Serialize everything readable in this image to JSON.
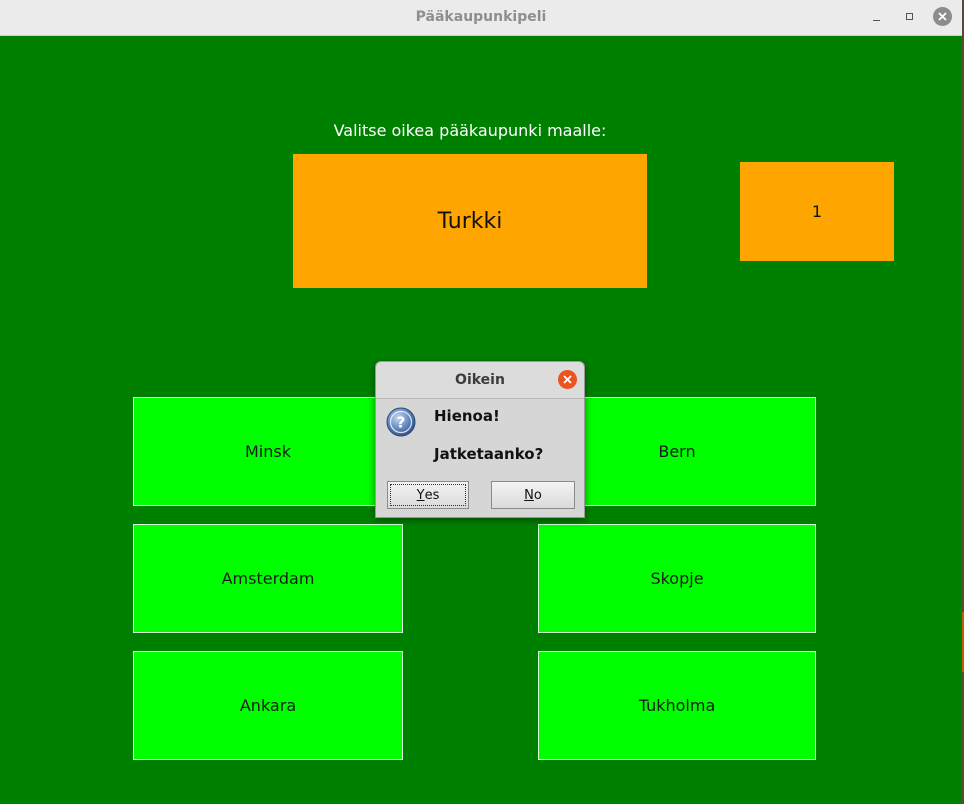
{
  "window": {
    "title": "Pääkaupunkipeli"
  },
  "game": {
    "prompt": "Valitse oikea pääkaupunki maalle:",
    "country": "Turkki",
    "score": "1",
    "answers": [
      "Minsk",
      "Bern",
      "Amsterdam",
      "Skopje",
      "Ankara",
      "Tukholma"
    ]
  },
  "dialog": {
    "title": "Oikein",
    "line1": "Hienoa!",
    "line2": "Jatketaanko?",
    "yes_mnemonic": "Y",
    "yes_rest": "es",
    "no_mnemonic": "N",
    "no_rest": "o",
    "icon": "question-icon"
  },
  "colors": {
    "background": "#008000",
    "country_box": "#ffa500",
    "answer_button": "#00ff00",
    "dialog_close": "#e95420"
  }
}
